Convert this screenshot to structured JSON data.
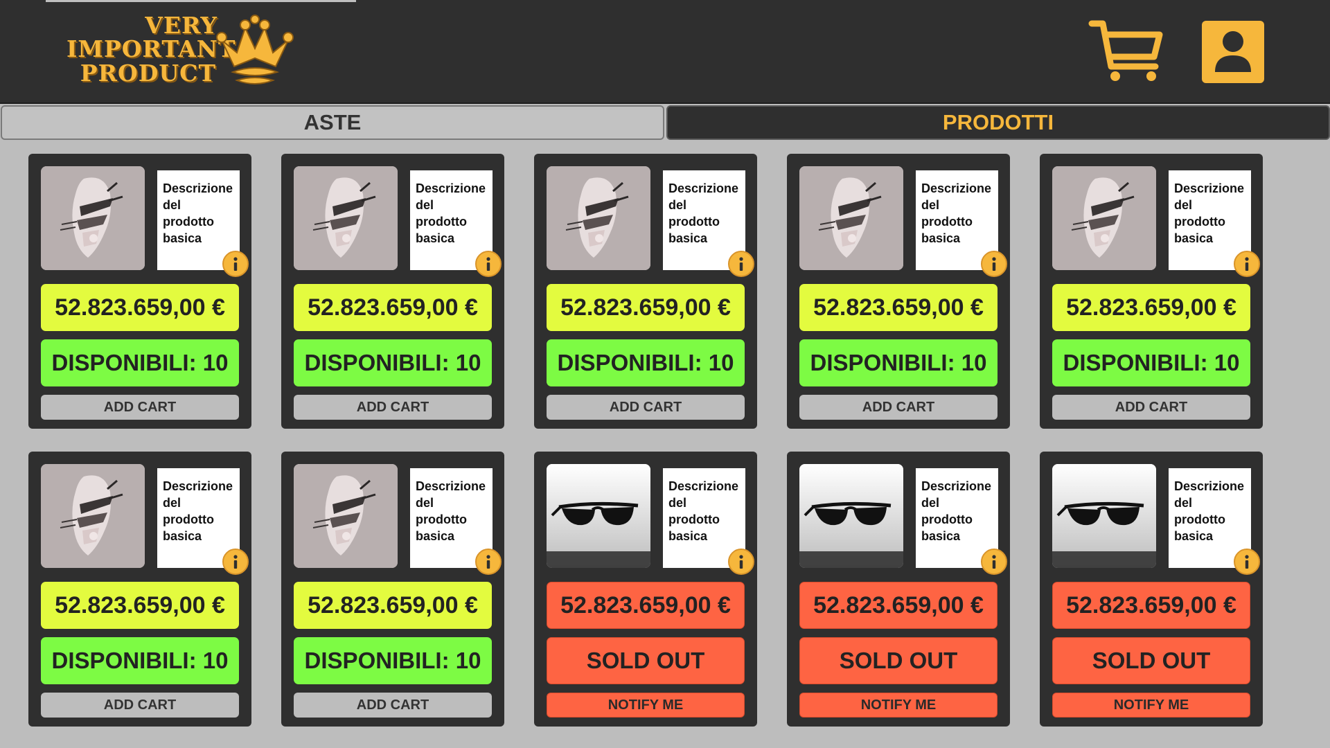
{
  "app": {
    "logo_lines": [
      "Very",
      "Important",
      "Product"
    ],
    "colors": {
      "accent": "#f6b73c",
      "header": "#2f2f2f",
      "background": "#bdbdbd"
    }
  },
  "header": {
    "cart_icon": "shopping-cart-icon",
    "user_icon": "user-profile-icon"
  },
  "tabs": [
    {
      "label": "ASTE",
      "active": false
    },
    {
      "label": "PRODOTTI",
      "active": true
    }
  ],
  "products": [
    {
      "image": "abstract-sculpture",
      "description": "Descrizione del prodotto basica",
      "price": "52.823.659,00 €",
      "status": "DISPONIBILI: 10",
      "action": "ADD CART",
      "sold_out": false
    },
    {
      "image": "abstract-sculpture",
      "description": "Descrizione del prodotto basica",
      "price": "52.823.659,00 €",
      "status": "DISPONIBILI: 10",
      "action": "ADD CART",
      "sold_out": false
    },
    {
      "image": "abstract-sculpture",
      "description": "Descrizione del prodotto basica",
      "price": "52.823.659,00 €",
      "status": "DISPONIBILI: 10",
      "action": "ADD CART",
      "sold_out": false
    },
    {
      "image": "abstract-sculpture",
      "description": "Descrizione del prodotto basica",
      "price": "52.823.659,00 €",
      "status": "DISPONIBILI: 10",
      "action": "ADD CART",
      "sold_out": false
    },
    {
      "image": "abstract-sculpture",
      "description": "Descrizione del prodotto basica",
      "price": "52.823.659,00 €",
      "status": "DISPONIBILI: 10",
      "action": "ADD CART",
      "sold_out": false
    },
    {
      "image": "abstract-sculpture",
      "description": "Descrizione del prodotto basica",
      "price": "52.823.659,00 €",
      "status": "DISPONIBILI: 10",
      "action": "ADD CART",
      "sold_out": false
    },
    {
      "image": "abstract-sculpture",
      "description": "Descrizione del prodotto basica",
      "price": "52.823.659,00 €",
      "status": "DISPONIBILI: 10",
      "action": "ADD CART",
      "sold_out": false
    },
    {
      "image": "sunglasses",
      "description": "Descrizione del prodotto basica",
      "price": "52.823.659,00 €",
      "status": "SOLD OUT",
      "action": "NOTIFY ME",
      "sold_out": true
    },
    {
      "image": "sunglasses",
      "description": "Descrizione del prodotto basica",
      "price": "52.823.659,00 €",
      "status": "SOLD OUT",
      "action": "NOTIFY ME",
      "sold_out": true
    },
    {
      "image": "sunglasses",
      "description": "Descrizione del prodotto basica",
      "price": "52.823.659,00 €",
      "status": "SOLD OUT",
      "action": "NOTIFY ME",
      "sold_out": true
    }
  ]
}
